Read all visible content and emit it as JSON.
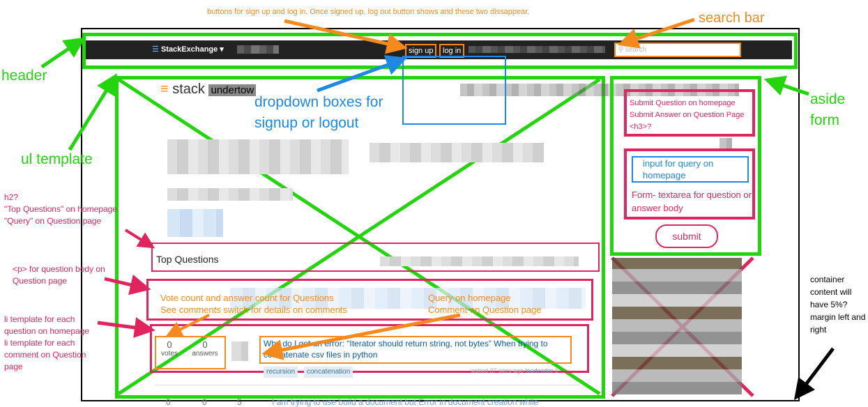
{
  "header": {
    "brand": "StackExchange ▾",
    "signup_label": "sign up",
    "login_label": "log in",
    "search_placeholder": "search",
    "logo_prefix": "stack",
    "logo_suffix": "undertow"
  },
  "main": {
    "section_title": "Top Questions",
    "question": {
      "votes": "0",
      "votes_label": "votes",
      "answers": "0",
      "answers_label": "answers",
      "title": "Why do I get an error: “Iterator should return string, not bytes” When trying to concatenate csv files in python",
      "tags": [
        "recursion",
        "concatenation"
      ],
      "asked": "asked 37 secs ago",
      "user": "leadcoder",
      "rep": "1"
    },
    "next_row": {
      "n1": "0",
      "n2": "0",
      "n3": "5",
      "snippet": "I am trying to use build a document but Error in document creation while"
    }
  },
  "annotations": {
    "buttons_note": "buttons for sign up and log in.  Once signed up, log out button shows and these two dissappear.",
    "search_bar": "search bar",
    "header": "header",
    "ul_template": "ul template",
    "dropdown": "dropdown boxes for signup or logout",
    "aside": "aside form",
    "h2_note": "h2?\n\"Top Questions\" on homepage\n\"Query\" on Question page",
    "p_note": "<p> for question body on Question page",
    "li_note": "li template for each question on homepage\nli template for each comment on Question page",
    "vote_note": "Vote count and answer count for Questions\nSee comments switch for details on comments",
    "query_note": "Query on homepage\nComment on Question page",
    "submit_note": "Submit Question on homepage\nSubmit Answer on Question Page <h3>?",
    "input_note": "input for query on homepage",
    "textarea_note": "Form- textarea for question or answer body",
    "submit_button": "submit",
    "container_note": "container content will have 5%? margin left and right"
  },
  "colors": {
    "green": "#23d40e",
    "red": "#e0245e",
    "orange": "#f48a1e",
    "blue": "#1e88e5",
    "dark_bar": "#222222"
  }
}
